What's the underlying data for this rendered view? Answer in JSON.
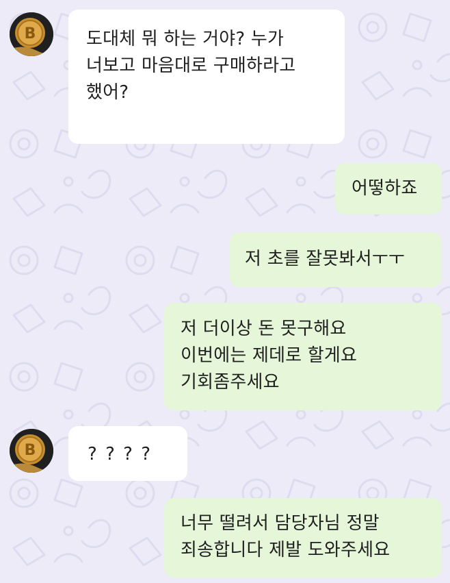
{
  "messages": [
    {
      "side": "in",
      "avatar": "bitcoin-coin-avatar",
      "text": "도대체 뭐 하는 거야? 누가\n너보고 마음대로 구매하라고\n했어?"
    },
    {
      "side": "out",
      "text": "어떻하죠"
    },
    {
      "side": "out",
      "text": "저 초를 잘못봐서ㅜㅜ"
    },
    {
      "side": "out",
      "text": "저 더이상 돈 못구해요\n이번에는 제데로 할게요\n기회좀주세요"
    },
    {
      "side": "in",
      "avatar": "bitcoin-coin-avatar",
      "text": "? ? ? ?"
    },
    {
      "side": "out",
      "text": "너무 떨려서 담당자님 정말\n죄송합니다 제발 도와주세요"
    }
  ],
  "colors": {
    "background": "#ecebf7",
    "incoming_bubble": "#ffffff",
    "outgoing_bubble": "#e6f7d9",
    "text": "#1f1f1f"
  }
}
